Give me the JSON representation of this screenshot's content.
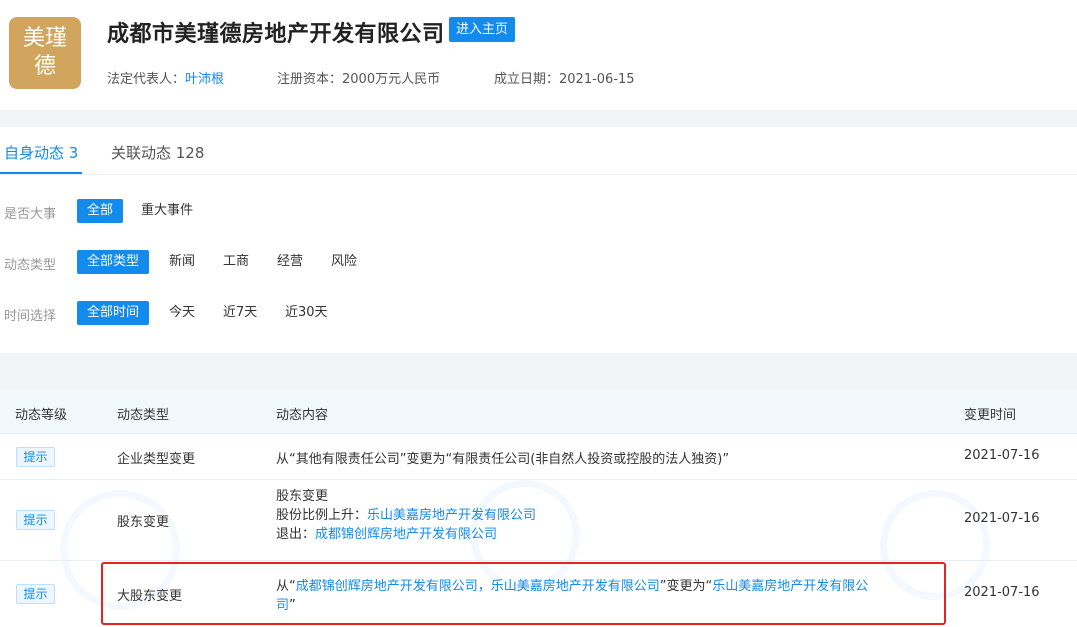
{
  "header": {
    "logo_lines": [
      "美瑾",
      "德"
    ],
    "company_name": "成都市美瑾德房地产开发有限公司",
    "home_button": "进入主页",
    "legal_rep_label": "法定代表人：",
    "legal_rep_value": "叶沛根",
    "capital_label": "注册资本：",
    "capital_value": "2000万元人民币",
    "founded_label": "成立日期：",
    "founded_value": "2021-06-15"
  },
  "tabs": [
    {
      "label": "自身动态 3",
      "active": true
    },
    {
      "label": "关联动态 128",
      "active": false
    }
  ],
  "filters": [
    {
      "label": "是否大事",
      "options": [
        "全部",
        "重大事件"
      ],
      "active": 0
    },
    {
      "label": "动态类型",
      "options": [
        "全部类型",
        "新闻",
        "工商",
        "经营",
        "风险"
      ],
      "active": 0
    },
    {
      "label": "时间选择",
      "options": [
        "全部时间",
        "今天",
        "近7天",
        "近30天"
      ],
      "active": 0
    }
  ],
  "table": {
    "headers": [
      "动态等级",
      "动态类型",
      "动态内容",
      "变更时间"
    ],
    "rows": [
      {
        "level": "提示",
        "type": "企业类型变更",
        "content_line1": "从“其他有限责任公司”变更为“有限责任公司(非自然人投资或控股的法人独资)”",
        "date": "2021-07-16"
      },
      {
        "level": "提示",
        "type": "股东变更",
        "content_title": "股东变更",
        "content_up_label": "股份比例上升：",
        "content_up_value": "乐山美嘉房地产开发有限公司",
        "content_out_label": "退出：",
        "content_out_value": "成都锦创辉房地产开发有限公司",
        "date": "2021-07-16"
      },
      {
        "level": "提示",
        "type": "大股东变更",
        "content_from_prefix": "从“",
        "content_from_value": "成都锦创辉房地产开发有限公司，乐山美嘉房地产开发有限公司",
        "content_mid": "”变更为“",
        "content_to_value_part1": "乐山美嘉房地产开发有限公",
        "content_to_value_part2": "司",
        "content_suffix": "”",
        "date": "2021-07-16"
      }
    ]
  },
  "colors": {
    "accent": "#128bed",
    "highlight": "#e8231f",
    "logo_bg": "#d2a55e"
  }
}
